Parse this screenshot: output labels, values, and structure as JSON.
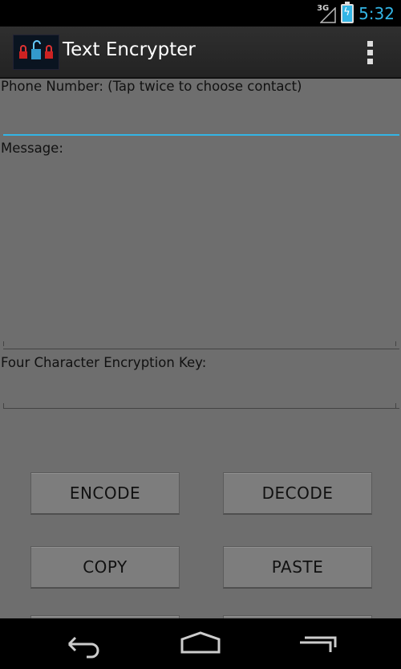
{
  "status": {
    "network_label": "3G",
    "time": "5:32"
  },
  "appbar": {
    "title": "Text Encrypter",
    "icon": "padlocks-icon",
    "overflow_icon": "overflow-menu-icon"
  },
  "form": {
    "phone_label": "Phone Number: (Tap twice to choose contact)",
    "phone_value": "",
    "message_label": "Message:",
    "message_value": "",
    "key_label": "Four Character Encryption Key:",
    "key_value": ""
  },
  "buttons": {
    "encode": "ENCODE",
    "decode": "DECODE",
    "copy": "COPY",
    "paste": "PASTE"
  },
  "navbar": {
    "back_icon": "back-icon",
    "home_icon": "home-icon",
    "recents_icon": "recents-icon"
  },
  "colors": {
    "accent": "#33b5e5",
    "background": "#6e6e6e",
    "actionbar": "#2a2a2a"
  }
}
